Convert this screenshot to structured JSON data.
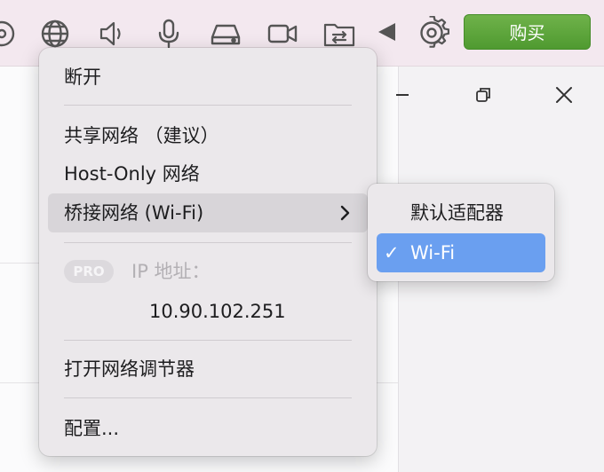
{
  "toolbar": {
    "icons": [
      "disc-icon",
      "globe-icon",
      "speaker-icon",
      "microphone-icon",
      "drive-icon",
      "camera-icon",
      "shared-folder-icon",
      "triangle-left-icon",
      "gear-icon"
    ],
    "buy_label": "购买",
    "buy_color": "#5aa637"
  },
  "menu": {
    "disconnect": "断开",
    "shared": "共享网络 （建议）",
    "host_only": "Host-Only 网络",
    "bridged": "桥接网络 (Wi-Fi)",
    "pro_badge": "PRO",
    "ip_label": "IP 地址：",
    "ip_value": "10.90.102.251",
    "open_net": "打开网络调节器",
    "configure": "配置..."
  },
  "submenu": {
    "default_adapter": "默认适配器",
    "wifi_check": "✓",
    "wifi": "Wi-Fi",
    "highlight_color": "#6a9ff0"
  }
}
